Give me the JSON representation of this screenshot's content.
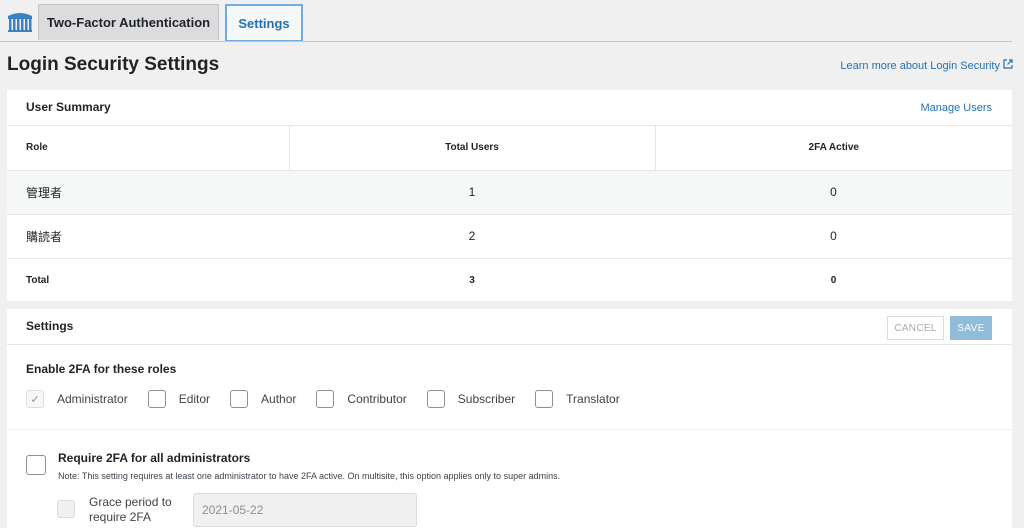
{
  "tabs": [
    {
      "label": "Two-Factor Authentication",
      "active": false
    },
    {
      "label": "Settings",
      "active": true
    }
  ],
  "page": {
    "title": "Login Security Settings",
    "learn_more": "Learn more about Login Security"
  },
  "user_summary": {
    "title": "User Summary",
    "manage_users": "Manage Users",
    "columns": [
      "Role",
      "Total Users",
      "2FA Active"
    ],
    "rows": [
      {
        "role": "管理者",
        "total": "1",
        "active": "0"
      },
      {
        "role": "購読者",
        "total": "2",
        "active": "0"
      }
    ],
    "total_row": {
      "role": "Total",
      "total": "3",
      "active": "0"
    }
  },
  "settings": {
    "title": "Settings",
    "cancel_label": "CANCEL",
    "save_label": "SAVE",
    "enable_roles_label": "Enable 2FA for these roles",
    "roles": [
      {
        "label": "Administrator",
        "checked": true,
        "disabled": true
      },
      {
        "label": "Editor",
        "checked": false
      },
      {
        "label": "Author",
        "checked": false
      },
      {
        "label": "Contributor",
        "checked": false
      },
      {
        "label": "Subscriber",
        "checked": false
      },
      {
        "label": "Translator",
        "checked": false
      }
    ],
    "require_admin": {
      "title": "Require 2FA for all administrators",
      "note": "Note: This setting requires at least one administrator to have 2FA active. On multisite, this option applies only to super admins.",
      "checked": false
    },
    "grace_period": {
      "label": "Grace period to require 2FA",
      "value": "2021-05-22",
      "disabled": true
    }
  },
  "colors": {
    "accent": "#2271b1",
    "save_disabled": "#8fbcd9",
    "background": "#f0f0f1"
  },
  "icons": {
    "logo": "wordfence-logo-icon",
    "external": "external-link-icon",
    "check": "checkmark-icon"
  }
}
